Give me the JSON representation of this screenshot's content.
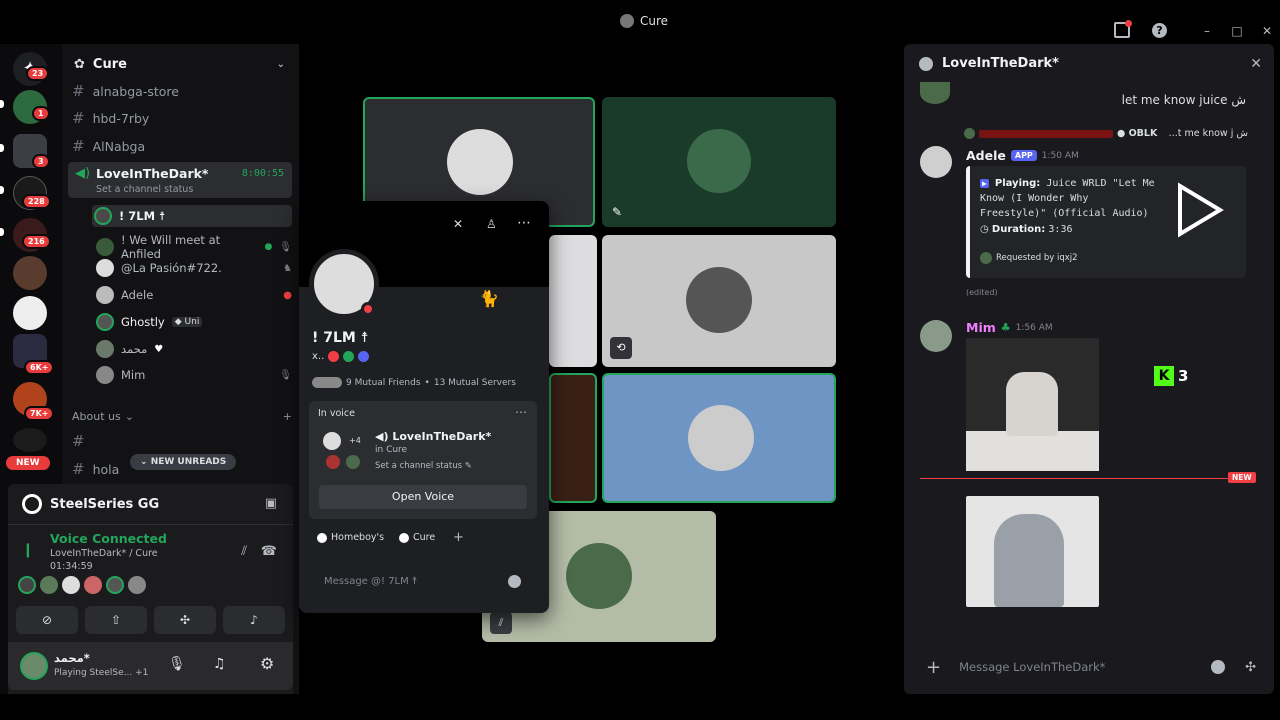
{
  "window": {
    "title": "Cure",
    "colors": {
      "accent_green": "#23a55a",
      "danger_red": "#f23f43",
      "blurple": "#5865f2"
    }
  },
  "rail": {
    "badges": [
      "23",
      "1",
      "3",
      "228",
      "216",
      "6K+",
      "7K+"
    ],
    "new_label": "NEW"
  },
  "sidebar": {
    "server_name": "Cure",
    "channels_top": [
      "alnabga-store",
      "hbd-7rby",
      "AlNabga"
    ],
    "voice_channel": {
      "name": "LoveInTheDark*",
      "timer": "8:00:55",
      "status_hint": "Set a channel status"
    },
    "voice_users": [
      {
        "name": "! 7LM ☨",
        "icon": "none"
      },
      {
        "name": "! We Will meet at Anfiled",
        "icon": "mic-off-icon"
      },
      {
        "name": "@La Pasión#722.",
        "icon": "deafen-icon"
      },
      {
        "name": "Adele",
        "icon": "live-icon"
      },
      {
        "name": "Ghostly",
        "tag": "Uni",
        "icon": "none"
      },
      {
        "name": "محمد",
        "icon": "heart"
      },
      {
        "name": "Mim",
        "icon": "mic-off-icon"
      }
    ],
    "category": "About us",
    "channels_bottom": [
      "",
      "hola"
    ],
    "new_unreads": "NEW UNREADS"
  },
  "activity": {
    "app_name": "SteelSeries GG",
    "voice_status": "Voice Connected",
    "voice_location": "LoveInTheDark* / Cure",
    "voice_timer": "01:34:59"
  },
  "userbar": {
    "display_name": "محمد*",
    "status": "Playing SteelSe...",
    "extra": "+1"
  },
  "popup": {
    "name": "! 7LM ☨",
    "tag_prefix": "x..",
    "mutual_friends": "9 Mutual Friends",
    "mutual_servers": "13 Mutual Servers",
    "dot": "•",
    "in_voice_label": "In voice",
    "voice_channel": "LoveInTheDark*",
    "voice_server": "in Cure",
    "voice_count": "+4",
    "channel_status": "Set a channel status",
    "open_voice": "Open Voice",
    "servers": [
      "Homeboy's",
      "Cure"
    ],
    "message_placeholder": "Message @! 7LM ☨"
  },
  "chat": {
    "channel_title": "LoveInTheDark*",
    "msg_top_text": "let me know juice ش",
    "reply_badge": "OBLK",
    "reply_text": "...t me know j ش",
    "adele": {
      "name": "Adele",
      "app_tag": "APP",
      "time": "1:50 AM",
      "playing_label": "Playing:",
      "track": "Juice WRLD \"Let Me Know (I Wonder Why Freestyle)\" (Official Audio)",
      "duration_label": "Duration:",
      "duration": "3:36",
      "requested": "Requested by iqxj2",
      "edited": "(edited)"
    },
    "mim": {
      "name": "Mim",
      "time": "1:56 AM"
    },
    "kick_count": "3",
    "new_divider": "NEW",
    "input_placeholder": "Message LoveInTheDark*"
  }
}
